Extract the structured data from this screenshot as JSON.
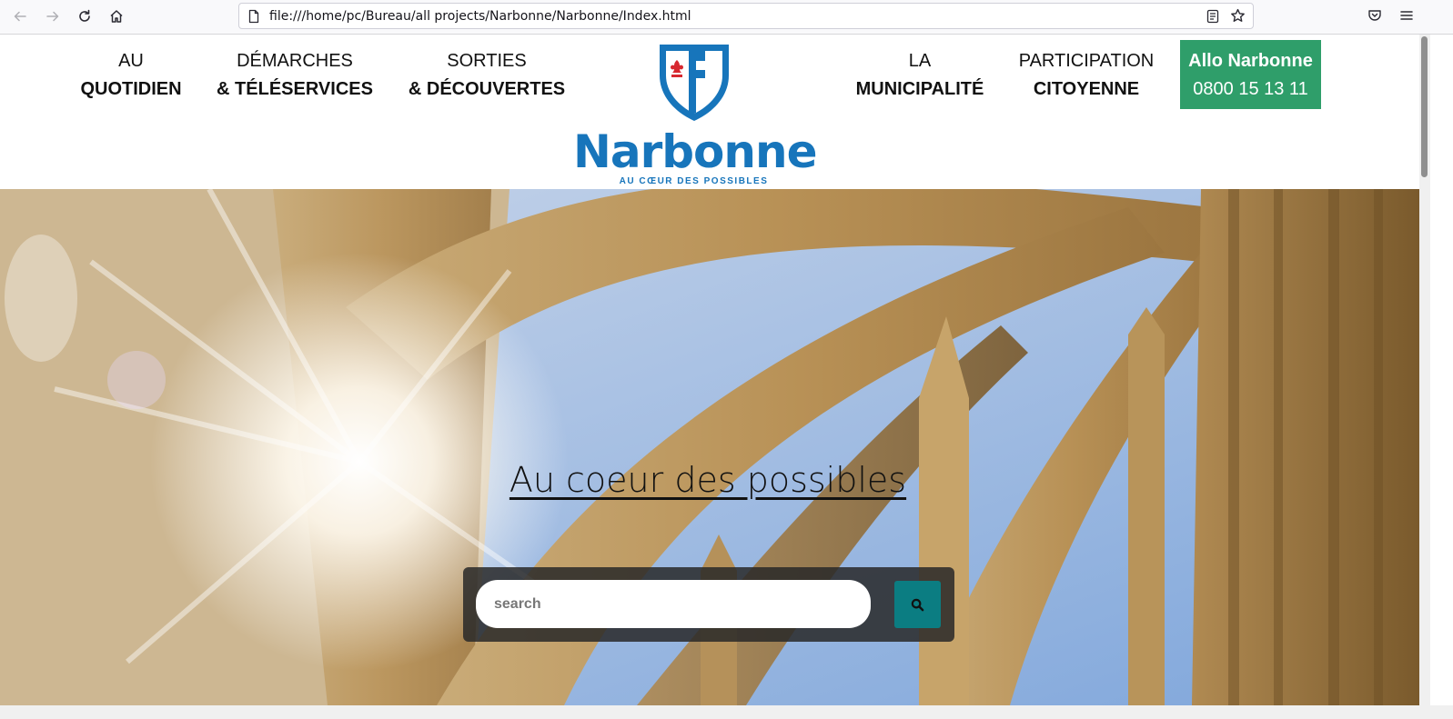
{
  "browser": {
    "url": "file:///home/pc/Bureau/all projects/Narbonne/Narbonne/Index.html",
    "icons": [
      "back-arrow-icon",
      "forward-arrow-icon",
      "reload-icon",
      "home-icon",
      "page-icon",
      "reader-view-icon",
      "bookmark-star-icon",
      "pocket-icon",
      "hamburger-menu-icon"
    ]
  },
  "header": {
    "menu": [
      {
        "line1": "AU",
        "line2": "QUOTIDIEN"
      },
      {
        "line1": "DÉMARCHES",
        "line2": "& TÉLÉSERVICES"
      },
      {
        "line1": "SORTIES",
        "line2": "& DÉCOUVERTES"
      },
      {
        "line1": "LA",
        "line2": "MUNICIPALITÉ"
      },
      {
        "line1": "PARTICIPATION",
        "line2": "CITOYENNE"
      }
    ],
    "allo": {
      "title": "Allo Narbonne",
      "phone": "0800 15 13 11",
      "color": "#2f9e6a"
    },
    "logo": {
      "name": "Narbonne",
      "tagline": "AU CŒUR DES POSSIBLES",
      "color": "#1775bb"
    }
  },
  "hero": {
    "title": "Au coeur des possibles",
    "search": {
      "placeholder": "search",
      "button_color": "#0b7d82"
    }
  }
}
